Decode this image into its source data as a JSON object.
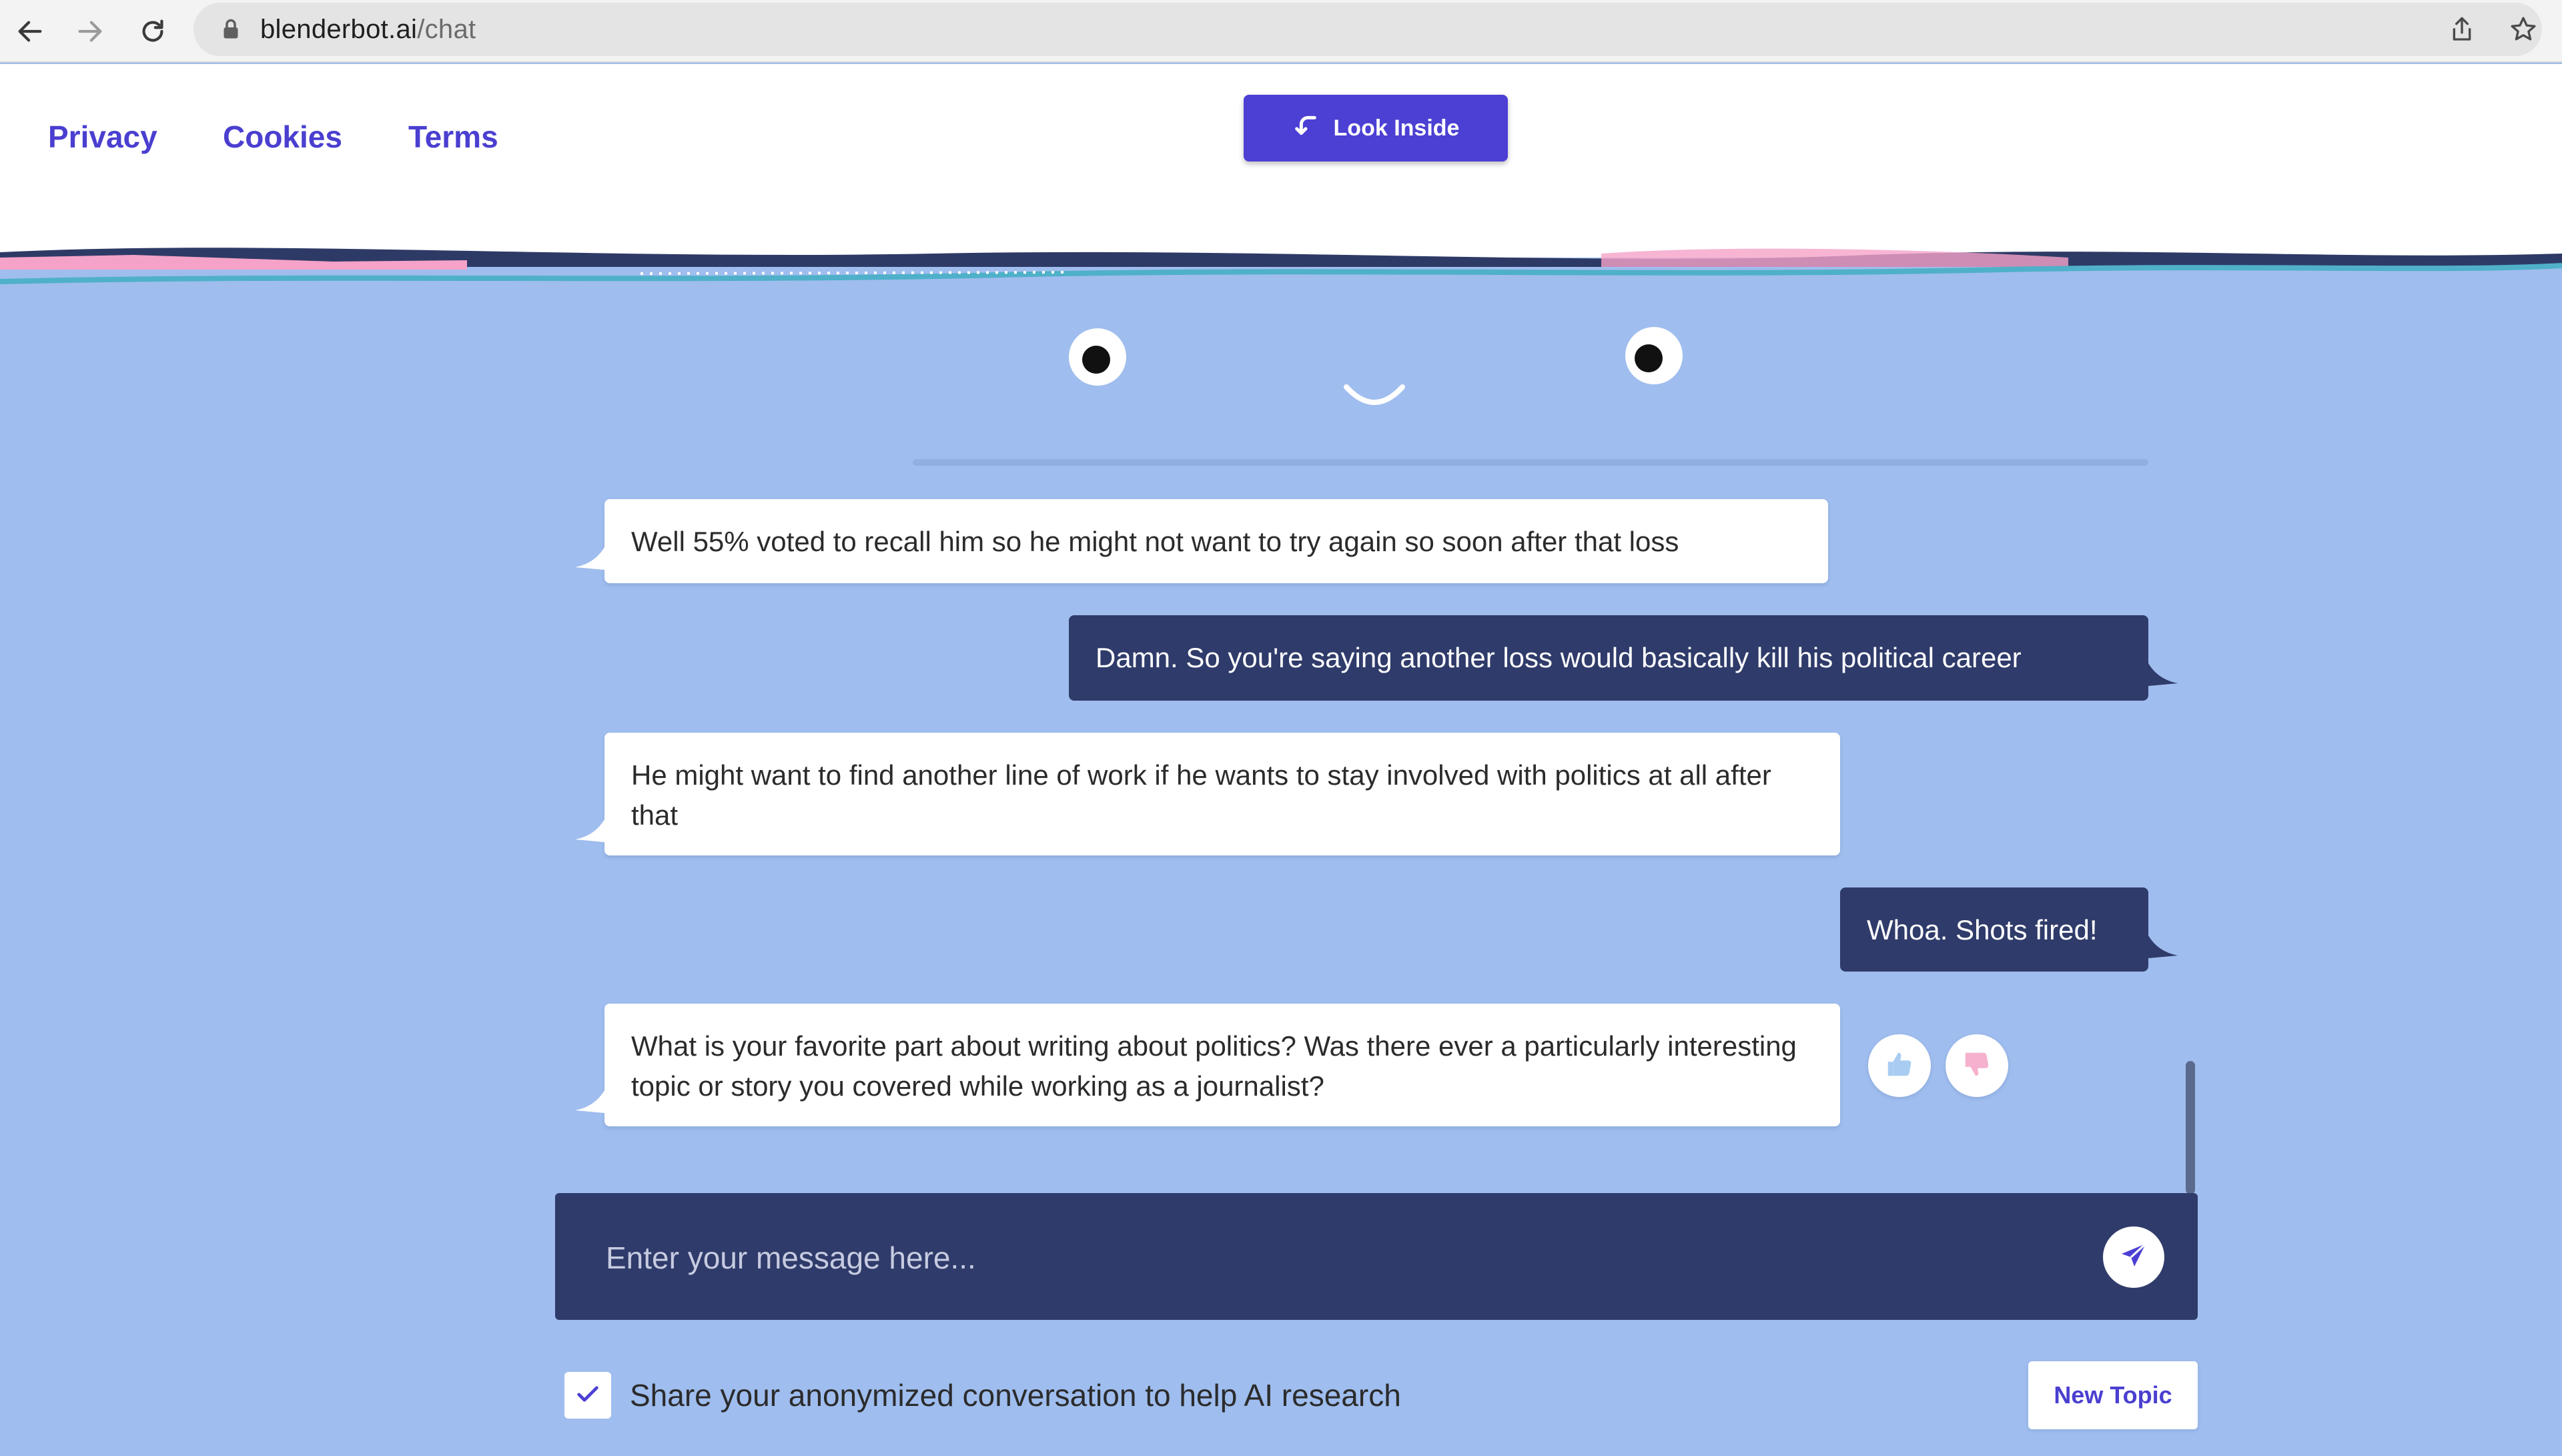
{
  "browser": {
    "url_domain": "blenderbot.ai",
    "url_path": "/chat",
    "icons": [
      "back-arrow-icon",
      "forward-arrow-icon",
      "reload-icon",
      "lock-icon",
      "share-icon",
      "star-icon"
    ]
  },
  "header": {
    "links": [
      {
        "label": "Privacy"
      },
      {
        "label": "Cookies"
      },
      {
        "label": "Terms"
      }
    ],
    "look_inside_label": "Look Inside"
  },
  "messages": [
    {
      "sender": "bot",
      "text": "Well 55% voted to recall him so he might not want to try again so soon after that loss"
    },
    {
      "sender": "user",
      "text": "Damn. So you're saying another loss would basically kill his political career"
    },
    {
      "sender": "bot",
      "text": "He might want to find another line of work if he wants to stay involved with politics at all after that"
    },
    {
      "sender": "user",
      "text": "Whoa. Shots fired!"
    },
    {
      "sender": "bot",
      "text": "What is your favorite part about writing about politics? Was there ever a particularly interesting topic or story you covered while working as a journalist?"
    }
  ],
  "composer": {
    "placeholder": "Enter your message here...",
    "value": ""
  },
  "footer": {
    "share_label": "Share your anonymized conversation to help AI research",
    "share_checked": true,
    "new_topic_label": "New Topic"
  },
  "colors": {
    "accent": "#4b3fd4",
    "background": "#9fbdee",
    "user_bubble": "#2f3b6a",
    "bot_bubble": "#ffffff"
  }
}
